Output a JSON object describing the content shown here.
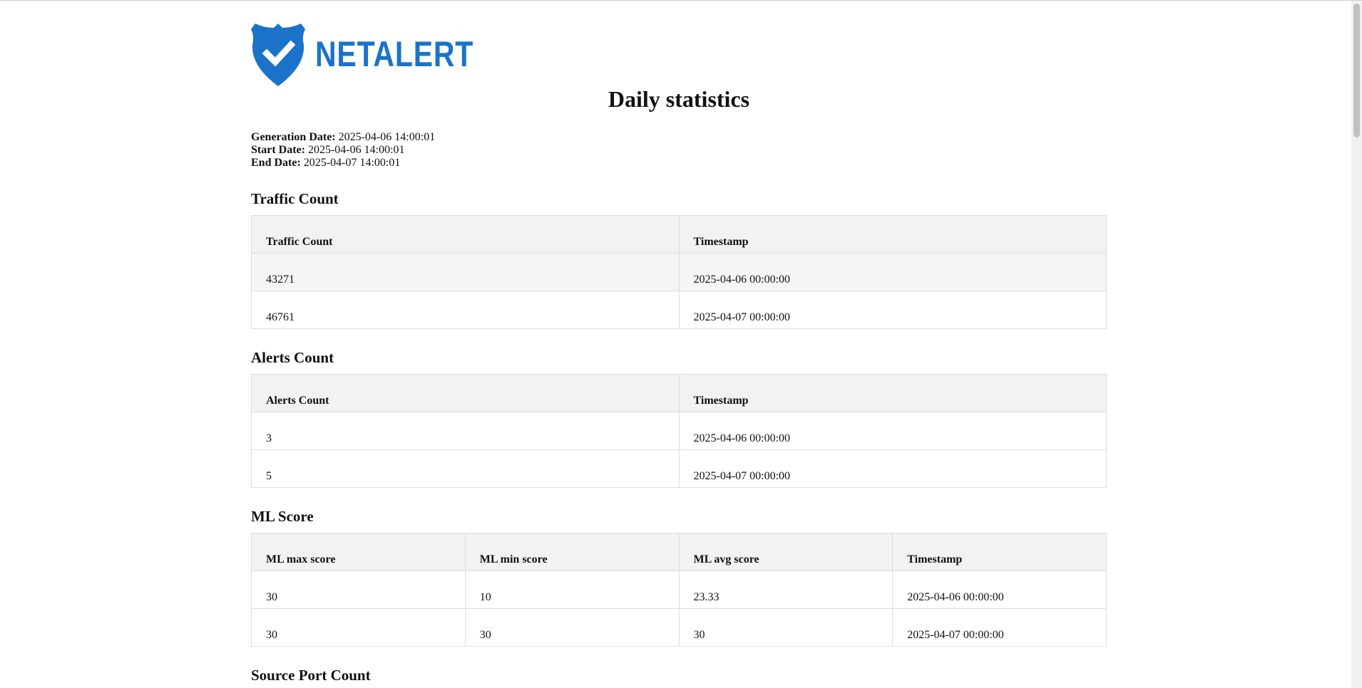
{
  "logo": {
    "text": "NETALERT",
    "brand_color": "#1a73c9"
  },
  "title": "Daily statistics",
  "meta": {
    "generation_label": "Generation Date:",
    "generation_value": "2025-04-06 14:00:01",
    "start_label": "Start Date:",
    "start_value": "2025-04-06 14:00:01",
    "end_label": "End Date:",
    "end_value": "2025-04-07 14:00:01"
  },
  "traffic": {
    "title": "Traffic Count",
    "headers": [
      "Traffic Count",
      "Timestamp"
    ],
    "rows": [
      [
        "43271",
        "2025-04-06 00:00:00"
      ],
      [
        "46761",
        "2025-04-07 00:00:00"
      ]
    ]
  },
  "alerts": {
    "title": "Alerts Count",
    "headers": [
      "Alerts Count",
      "Timestamp"
    ],
    "rows": [
      [
        "3",
        "2025-04-06 00:00:00"
      ],
      [
        "5",
        "2025-04-07 00:00:00"
      ]
    ]
  },
  "ml": {
    "title": "ML Score",
    "headers": [
      "ML max score",
      "ML min score",
      "ML avg score",
      "Timestamp"
    ],
    "rows": [
      [
        "30",
        "10",
        "23.33",
        "2025-04-06 00:00:00"
      ],
      [
        "30",
        "30",
        "30",
        "2025-04-07 00:00:00"
      ]
    ]
  },
  "source_port": {
    "title": "Source Port Count"
  }
}
